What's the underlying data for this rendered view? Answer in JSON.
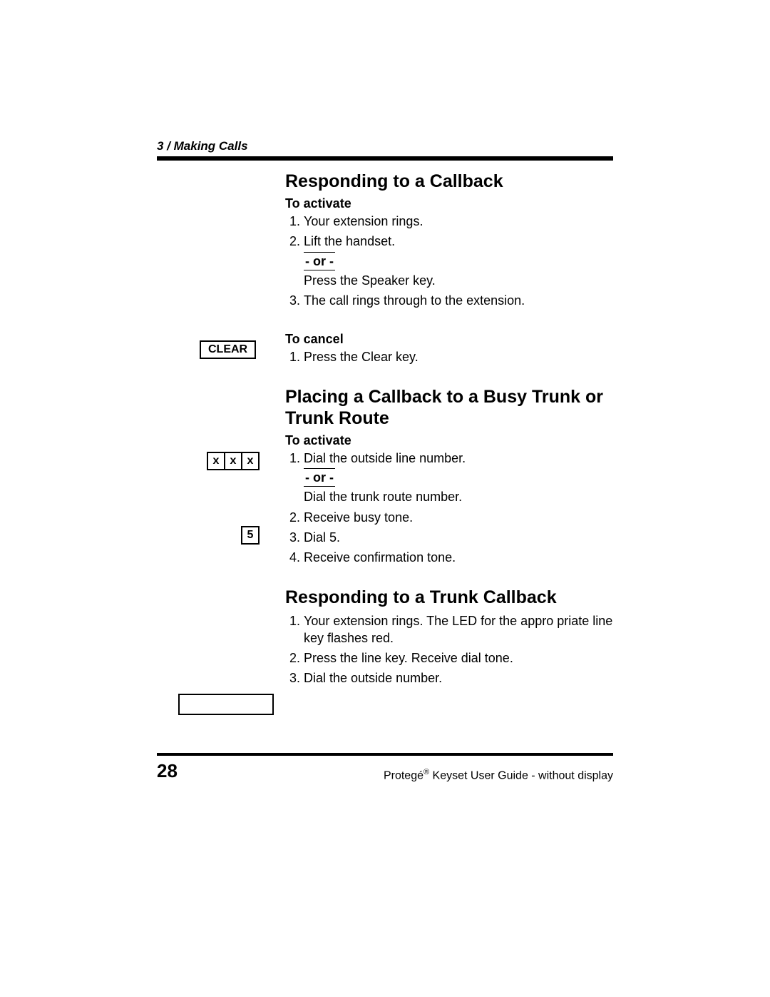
{
  "header": {
    "chapter": "3 / Making Calls"
  },
  "sec1": {
    "title": "Responding to a Callback",
    "activate_label": "To activate",
    "s1": "Your extension rings.",
    "s2a": "Lift the handset.",
    "or": "- or -",
    "s2b": "Press the Speaker key.",
    "s3": "The call rings through to the extension.",
    "cancel_label": "To cancel",
    "c1": "Press the Clear key.",
    "clear_key": "CLEAR"
  },
  "sec2": {
    "title": "Placing a Callback to a Busy Trunk or Trunk Route",
    "activate_label": "To activate",
    "s1a": "Dial the outside line number.",
    "or": "- or -",
    "s1b": "Dial the trunk route number.",
    "s2": "Receive busy tone.",
    "s3": "Dial 5.",
    "s4": "Receive confirmation tone.",
    "xxx": {
      "a": "x",
      "b": "x",
      "c": "x"
    },
    "five": "5"
  },
  "sec3": {
    "title": "Responding to a Trunk Callback",
    "s1": "Your extension rings. The LED for the appro priate line key flashes red.",
    "s2": "Press the line key. Receive dial tone.",
    "s3": "Dial the outside number.",
    "blank_key": " "
  },
  "footer": {
    "page": "28",
    "guide_a": "Protegé",
    "reg": "®",
    "guide_b": " Keyset User Guide - without display"
  }
}
